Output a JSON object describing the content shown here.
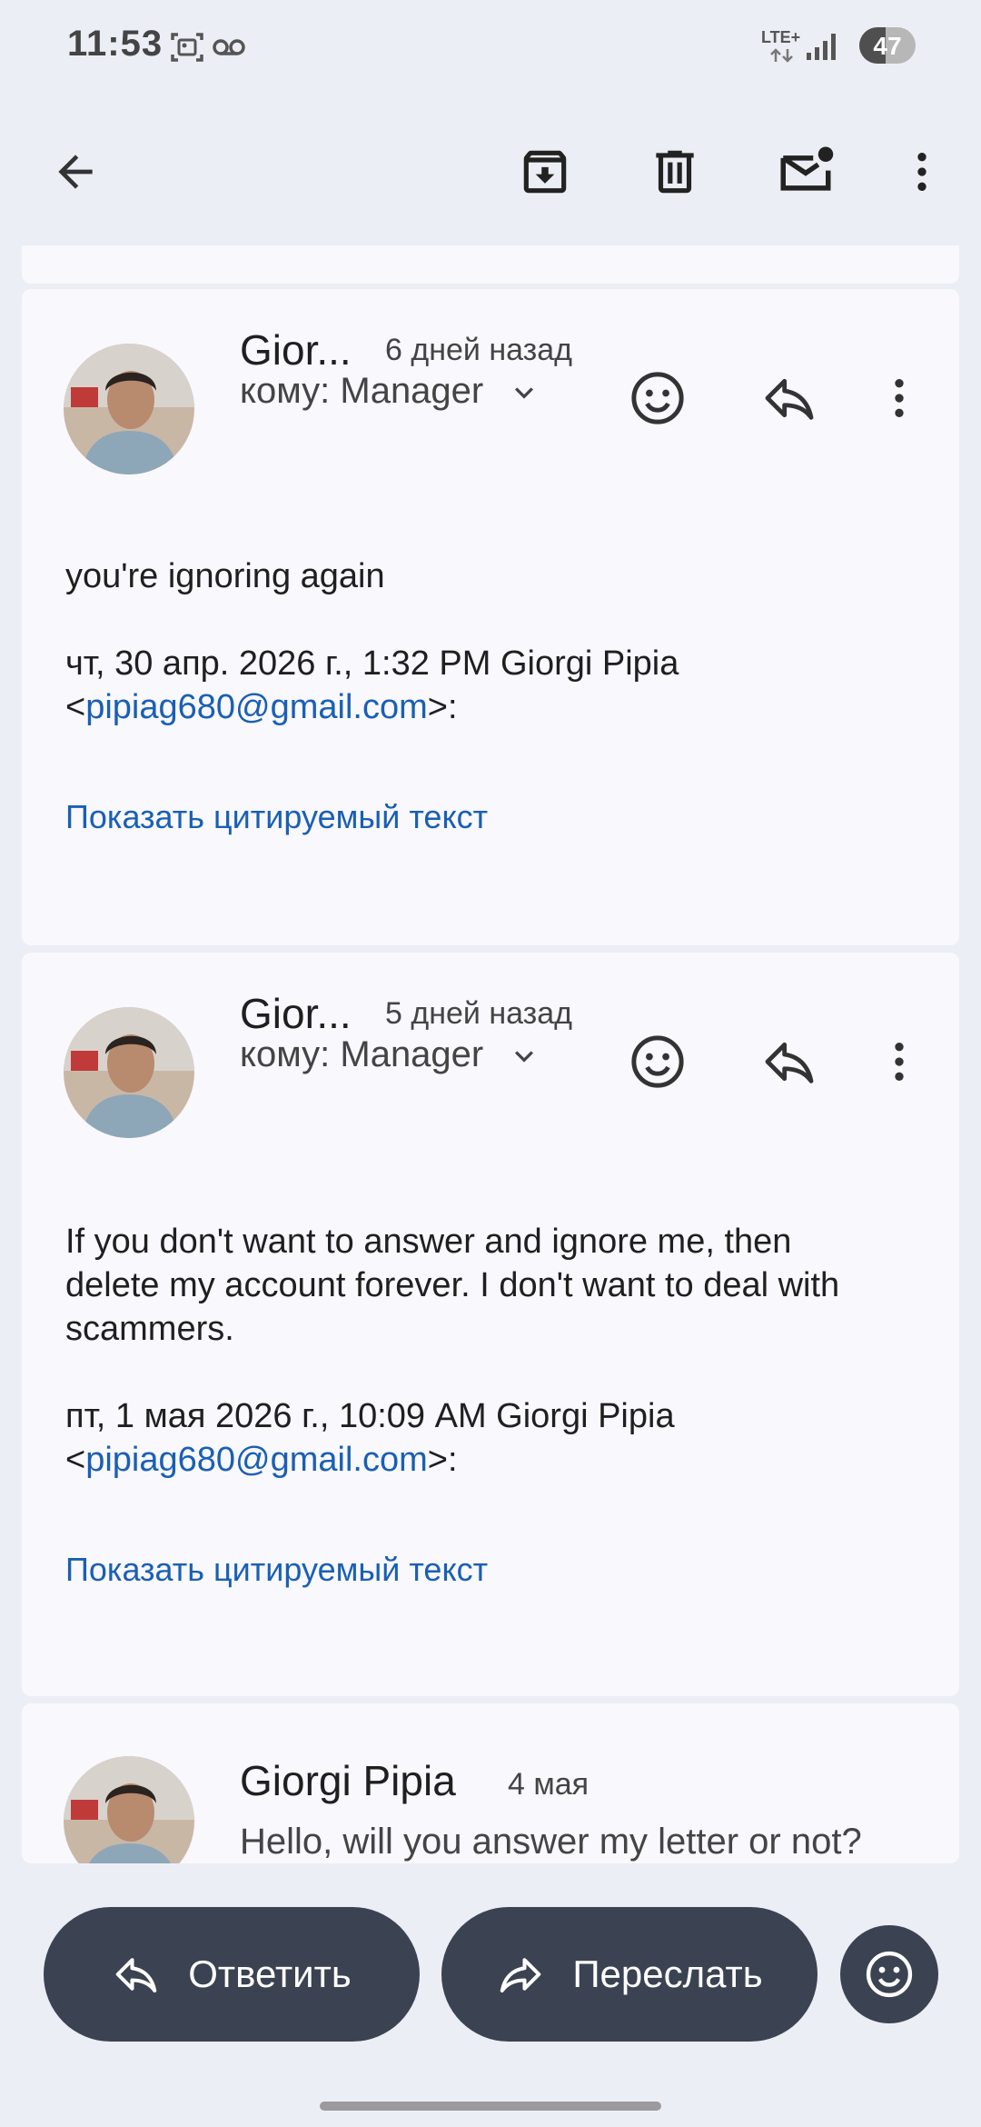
{
  "status_bar": {
    "time": "11:53",
    "network": "LTE+",
    "battery": "47",
    "battery_level": 0.47
  },
  "toolbar": {
    "icons": [
      "back-arrow-icon",
      "archive-icon",
      "delete-icon",
      "mark-unread-icon",
      "more-vert-icon"
    ]
  },
  "messages": [
    {
      "sender_short": "Gior...",
      "time": "6 дней назад",
      "recipient": "кому: Manager",
      "body": "you're ignoring again",
      "quote_header": "чт, 30 апр. 2026 г., 1:32 PM Giorgi Pipia",
      "email_open": "<",
      "email": "pipiag680@gmail.com",
      "email_close": ">:",
      "show_quoted": "Показать цитируемый текст"
    },
    {
      "sender_short": "Gior...",
      "time": "5 дней назад",
      "recipient": "кому: Manager",
      "body_lines": [
        "If you don't want to answer and ignore me, then",
        "delete my account forever. I don't want to deal with",
        "scammers."
      ],
      "quote_header": "пт, 1 мая 2026 г., 10:09 AM Giorgi Pipia",
      "email_open": "<",
      "email": "pipiag680@gmail.com",
      "email_close": ">:",
      "show_quoted": "Показать цитируемый текст"
    },
    {
      "sender": "Giorgi Pipia",
      "time": "4 мая",
      "snippet": "Hello, will you answer my letter or not?"
    }
  ],
  "actions": {
    "reply": "Ответить",
    "forward": "Переслать"
  },
  "colors": {
    "background": "#eceef5",
    "card": "#f8f8fd",
    "link": "#1a5fb4",
    "action_button": "#3b4251"
  }
}
